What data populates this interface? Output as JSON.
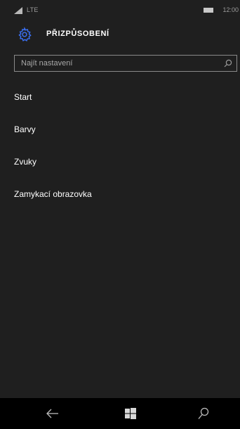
{
  "status_bar": {
    "network": "LTE",
    "time": "12:00"
  },
  "header": {
    "title": "PŘIZPŮSOBENÍ",
    "accent_color": "#3a6ff0"
  },
  "search": {
    "placeholder": "Najít nastavení",
    "value": ""
  },
  "menu": {
    "items": [
      {
        "label": "Start"
      },
      {
        "label": "Barvy"
      },
      {
        "label": "Zvuky"
      },
      {
        "label": "Zamykací obrazovka"
      }
    ]
  },
  "nav_bar": {
    "icons": [
      "back-arrow-icon",
      "windows-icon",
      "search-icon"
    ]
  }
}
